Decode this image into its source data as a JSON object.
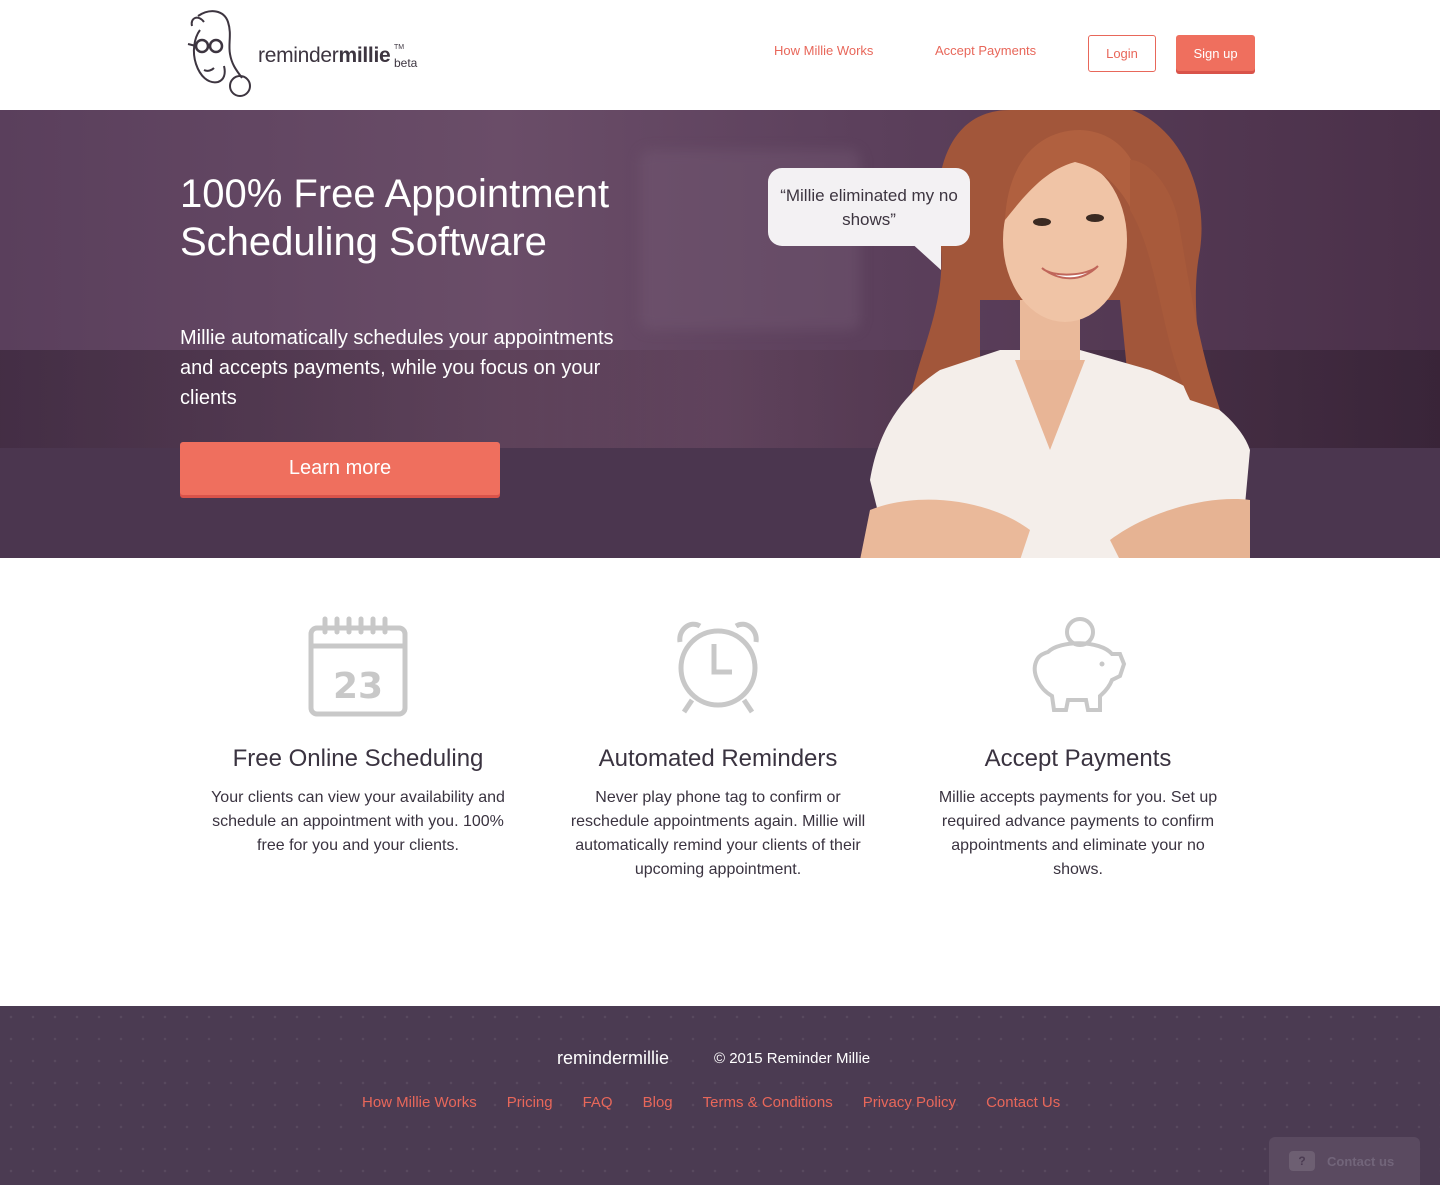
{
  "header": {
    "logo": {
      "text_light": "reminder",
      "text_bold": "millie",
      "tm": "TM",
      "beta": "beta"
    },
    "nav": [
      {
        "label": "How Millie Works"
      },
      {
        "label": "Accept Payments"
      }
    ],
    "login_label": "Login",
    "signup_label": "Sign up"
  },
  "hero": {
    "title": "100% Free Appointment Scheduling Software",
    "subtitle": "Millie automatically schedules your appointments and accepts payments, while you focus on your clients",
    "cta_label": "Learn more",
    "quote": "“Millie eliminated my no shows”"
  },
  "features": [
    {
      "icon": "calendar-icon",
      "icon_number": "23",
      "title": "Free Online Scheduling",
      "description": "Your clients can view your availability and schedule an appointment with you. 100% free for you and your clients."
    },
    {
      "icon": "alarm-clock-icon",
      "title": "Automated Reminders",
      "description": "Never play phone tag to confirm or reschedule appointments again. Millie will automatically remind your clients of their upcoming appointment."
    },
    {
      "icon": "piggy-bank-icon",
      "title": "Accept Payments",
      "description": "Millie accepts payments for you. Set up required advance payments to confirm appointments and eliminate your no shows."
    }
  ],
  "footer": {
    "brand": "remindermillie",
    "copyright": "© 2015 Reminder Millie",
    "links": [
      {
        "label": "How Millie Works"
      },
      {
        "label": "Pricing"
      },
      {
        "label": "FAQ"
      },
      {
        "label": "Blog"
      },
      {
        "label": "Terms & Conditions"
      },
      {
        "label": "Privacy Policy"
      },
      {
        "label": "Contact Us"
      }
    ]
  },
  "contact_widget": {
    "label": "Contact us",
    "icon": "chat-icon"
  },
  "colors": {
    "accent": "#ef6f5e",
    "hero_bg": "#4d3650",
    "footer_bg": "#4b3b52",
    "icon_gray": "#c8c8c8"
  }
}
